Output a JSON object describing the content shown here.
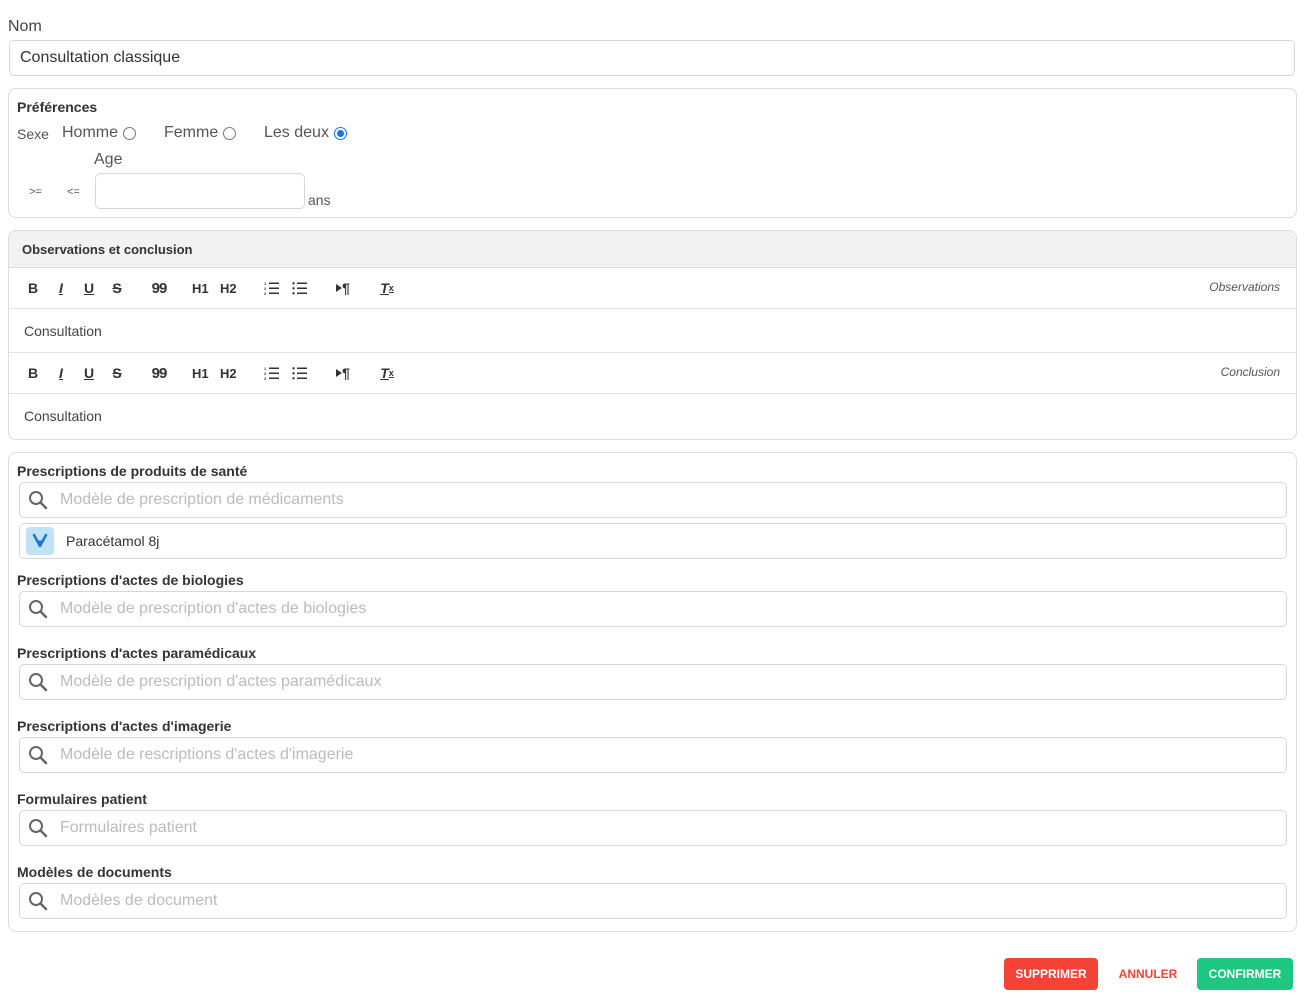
{
  "nom": {
    "label": "Nom",
    "value": "Consultation classique"
  },
  "preferences": {
    "title": "Préférences",
    "sexe_label": "Sexe",
    "options": [
      {
        "label": "Homme",
        "checked": false
      },
      {
        "label": "Femme",
        "checked": false
      },
      {
        "label": "Les deux",
        "checked": true
      }
    ],
    "age_label": "Age",
    "gte": ">=",
    "lte": "<=",
    "age_value": "",
    "unit": "ans"
  },
  "obs_conclusion": {
    "title": "Observations et conclusion",
    "toolbar": {
      "bold": "B",
      "italic": "I",
      "underline": "U",
      "strike": "S",
      "quote": "99",
      "h1": "H1",
      "h2": "H2",
      "pilcrow": "¶",
      "clear": "T"
    },
    "editors": [
      {
        "label": "Observations",
        "content": "Consultation"
      },
      {
        "label": "Conclusion",
        "content": "Consultation"
      }
    ]
  },
  "prescriptions": {
    "sante": {
      "title": "Prescriptions de produits de santé",
      "placeholder": "Modèle de prescription de médicaments",
      "items": [
        "Paracétamol 8j"
      ]
    },
    "biologies": {
      "title": "Prescriptions d'actes de biologies",
      "placeholder": "Modèle de prescription d'actes de biologies"
    },
    "paramedicaux": {
      "title": "Prescriptions d'actes paramédicaux",
      "placeholder": "Modèle de prescription d'actes paramédicaux"
    },
    "imagerie": {
      "title": "Prescriptions d'actes d'imagerie",
      "placeholder": "Modèle de rescriptions d'actes d'imagerie"
    },
    "formulaires": {
      "title": "Formulaires patient",
      "placeholder": "Formulaires patient"
    },
    "documents": {
      "title": "Modèles de documents",
      "placeholder": "Modèles de document"
    }
  },
  "actions": {
    "delete": "SUPPRIMER",
    "cancel": "ANNULER",
    "confirm": "CONFIRMER"
  },
  "colors": {
    "danger": "#f44336",
    "success": "#1ec780",
    "radio_accent": "#1a73e8",
    "item_icon_bg": "#bfe3f4"
  }
}
